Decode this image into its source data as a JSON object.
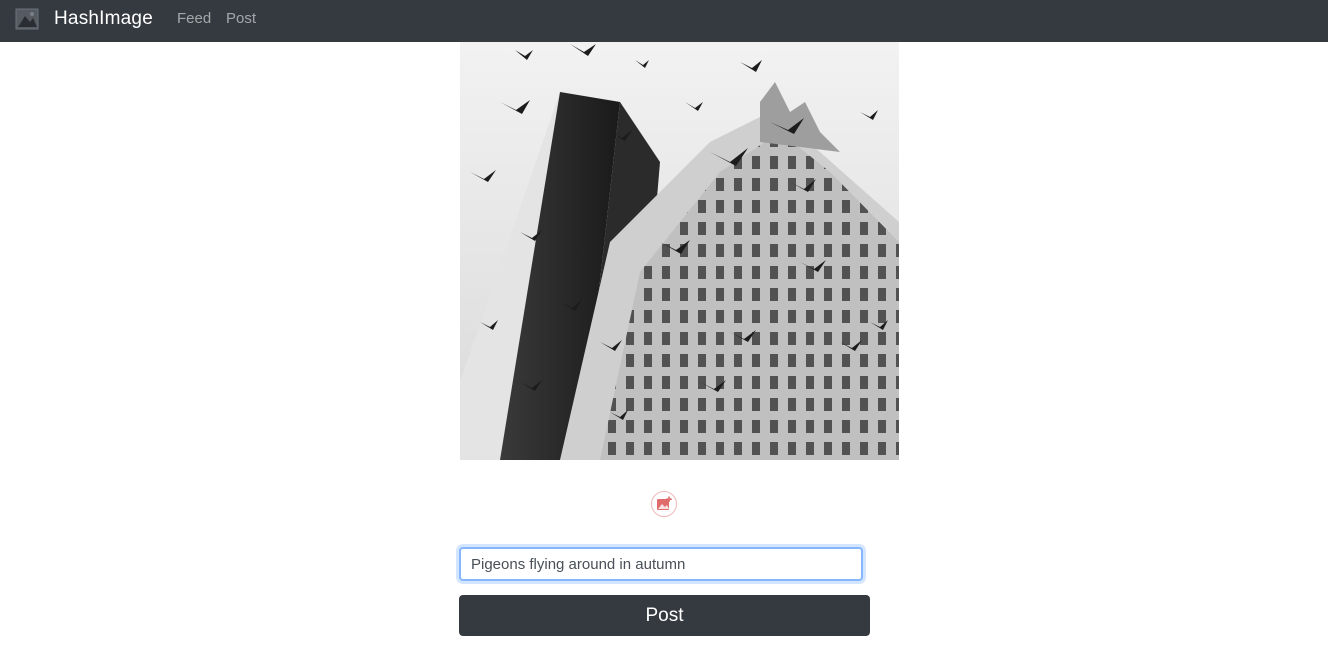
{
  "navbar": {
    "brand": "HashImage",
    "logo_icon": "image-icon",
    "links": [
      {
        "label": "Feed"
      },
      {
        "label": "Post"
      }
    ]
  },
  "post_form": {
    "add_image_icon": "add-image-icon",
    "caption_value": "Pigeons flying around in autumn",
    "submit_label": "Post"
  },
  "colors": {
    "navbar_bg": "#343a40",
    "button_bg": "#343a40",
    "focus_border": "#86b7fe",
    "add_icon": "#e06b6b"
  }
}
